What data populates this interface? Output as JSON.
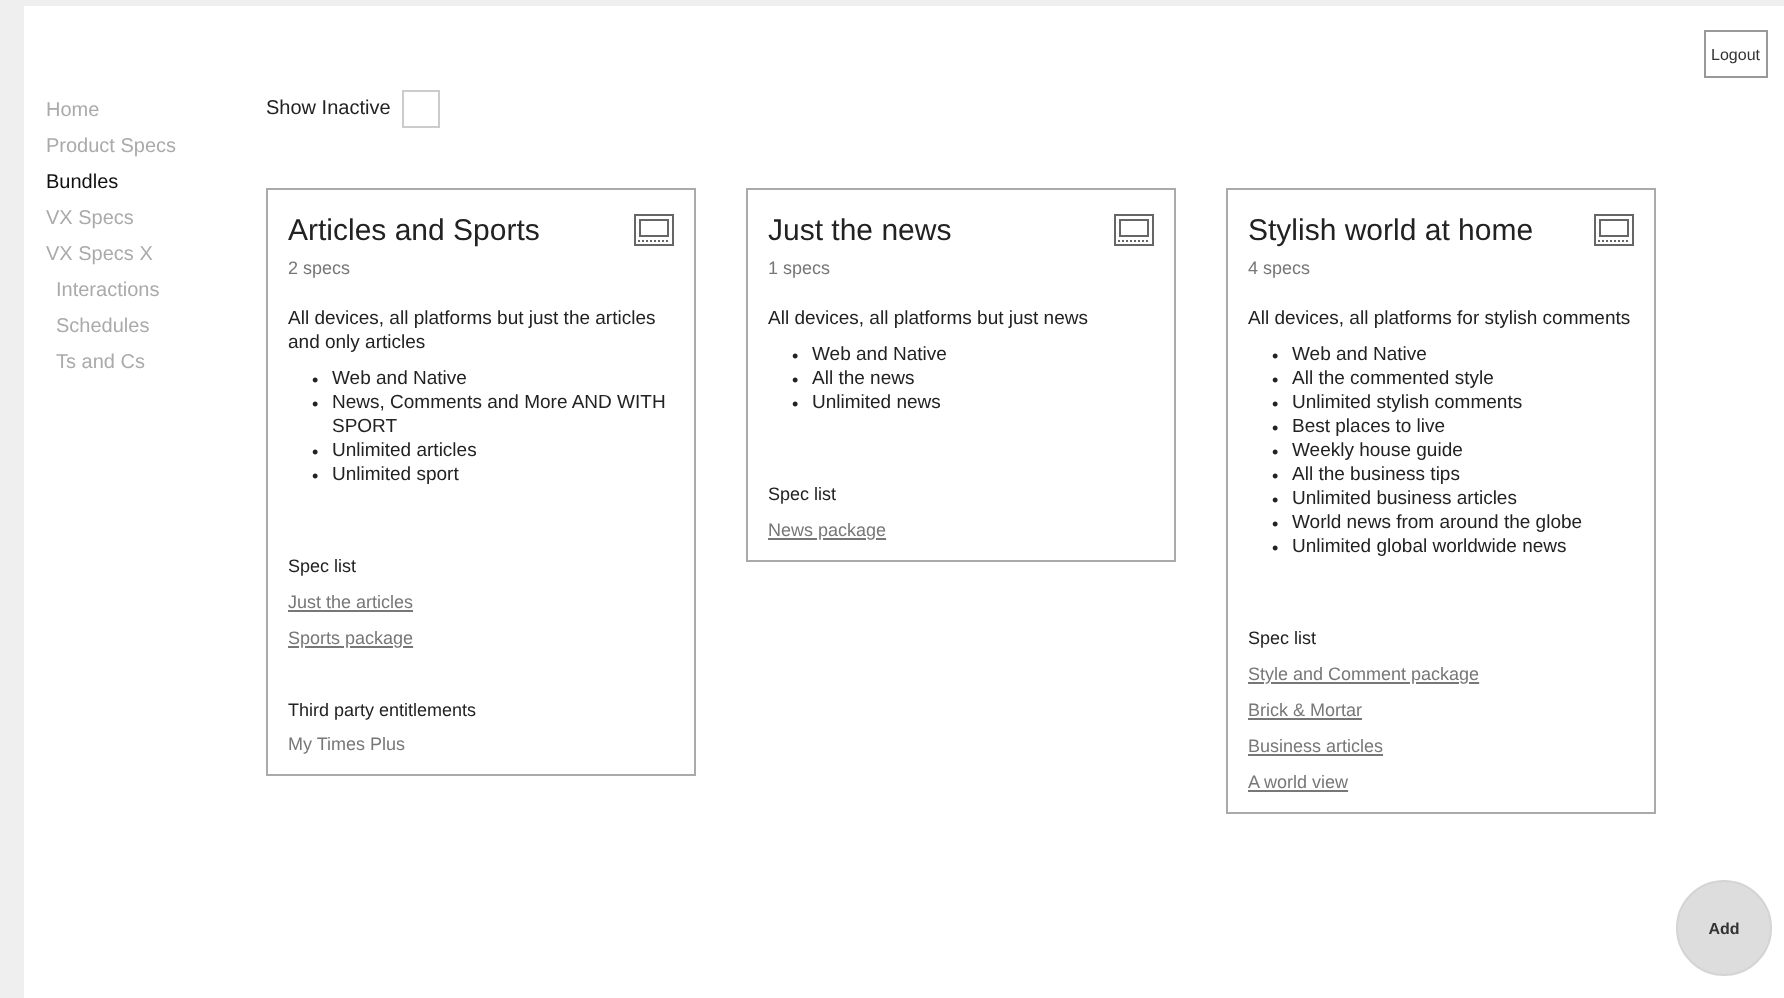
{
  "header": {
    "logout": "Logout"
  },
  "sidebar": {
    "items": [
      {
        "label": "Home",
        "selected": false
      },
      {
        "label": "Product Specs",
        "selected": false
      },
      {
        "label": "Bundles",
        "selected": true
      },
      {
        "label": "VX Specs",
        "selected": false
      },
      {
        "label": "VX Specs X",
        "selected": false,
        "children": [
          {
            "label": "Interactions",
            "selected": false
          },
          {
            "label": "Schedules",
            "selected": false
          },
          {
            "label": "Ts and Cs",
            "selected": false
          }
        ]
      }
    ]
  },
  "filter": {
    "label": "Show Inactive",
    "checked": false
  },
  "bundles": [
    {
      "marker": "•",
      "title": "Articles and Sports",
      "count": "2 specs",
      "description": "All devices, all platforms but just the articles and only articles",
      "features": [
        "Web and Native",
        "News, Comments and More AND WITH SPORT",
        "Unlimited articles",
        "Unlimited sport"
      ],
      "spec_heading": "Spec list",
      "specs": [
        "Just the articles",
        "Sports package"
      ],
      "entitlements_heading": "Third party entitlements",
      "entitlements": [
        "My Times Plus"
      ]
    },
    {
      "marker": "•",
      "title": "Just the news",
      "count": "1 specs",
      "description": "All devices, all platforms but just news",
      "features": [
        "Web and Native",
        "All the news",
        "Unlimited news"
      ],
      "spec_heading": "Spec list",
      "specs": [
        "News package"
      ]
    },
    {
      "marker": "•",
      "title": "Stylish world at home",
      "count": "4 specs",
      "description": "All devices, all platforms for stylish comments",
      "features": [
        "Web and Native",
        "All the commented style",
        "Unlimited stylish comments",
        "Best places to live",
        "Weekly house guide",
        "All the business tips",
        "Unlimited business articles",
        "World news from around the globe",
        "Unlimited global worldwide news"
      ],
      "spec_heading": "Spec list",
      "specs": [
        "Style and Comment package",
        "Brick & Mortar",
        "Business articles",
        "A world view"
      ]
    }
  ],
  "add_button": "Add"
}
